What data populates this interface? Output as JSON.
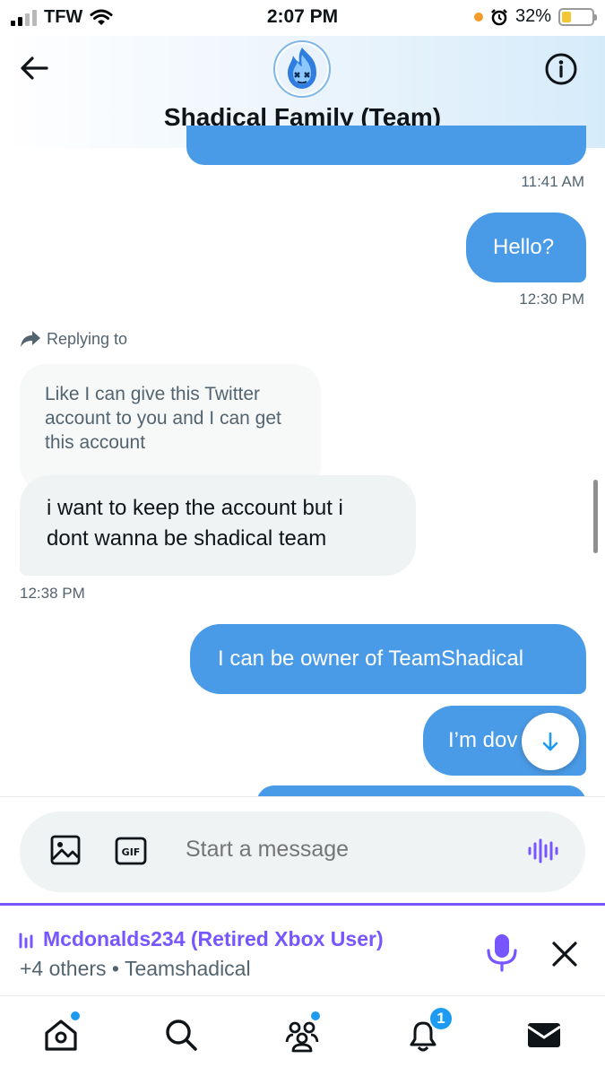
{
  "status": {
    "carrier": "TFW",
    "time": "2:07 PM",
    "battery": "32%"
  },
  "header": {
    "title": "Shadical Family (Team)"
  },
  "messages": {
    "ts1": "11:41 AM",
    "hello": "Hello?",
    "ts2": "12:30 PM",
    "replying_to": "Replying to",
    "quoted": "Like I can give this Twitter account to you and I can get this account",
    "incoming": "i want to keep the account but i dont wanna be shadical team",
    "ts3": "12:38 PM",
    "out1": "I can be owner of TeamShadical",
    "out2": "I’m dov"
  },
  "composer": {
    "placeholder": "Start a message"
  },
  "space": {
    "host": "Mcdonalds234 (Retired Xbox User)",
    "subtitle": "+4 others • Teamshadical"
  },
  "tabs": {
    "notifications_count": "1"
  },
  "colors": {
    "accent": "#1d9bf0",
    "bubble_out": "#4a9be7",
    "space_purple": "#7856ff"
  }
}
